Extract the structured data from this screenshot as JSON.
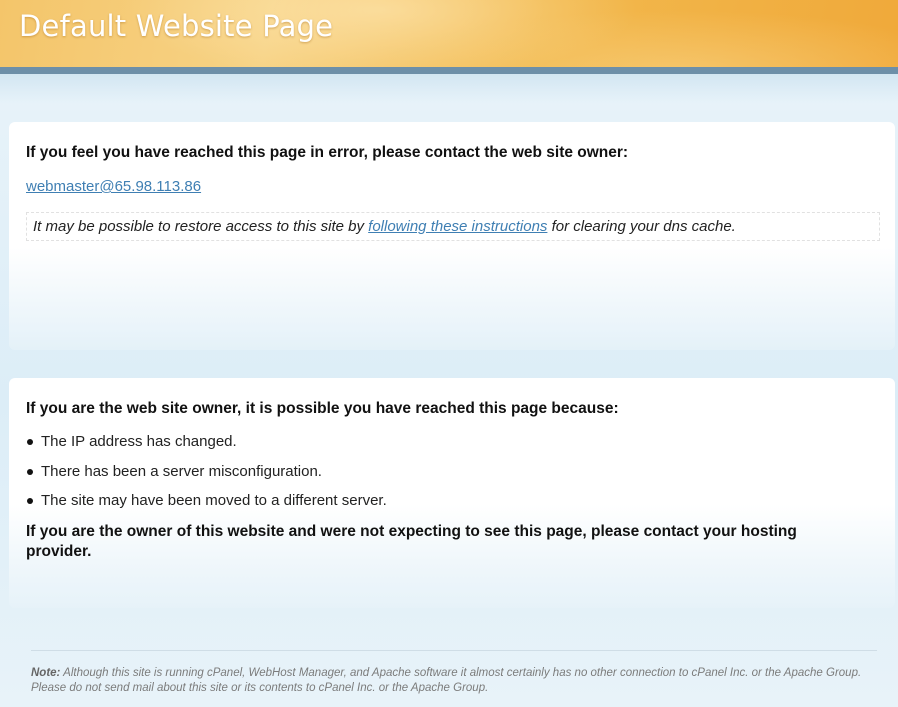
{
  "header": {
    "title": "Default Website Page"
  },
  "error_panel": {
    "heading": "If you feel you have reached this page in error, please contact the web site owner:",
    "email": "webmaster@65.98.113.86",
    "dns_prefix": "It may be possible to restore access to this site by ",
    "dns_link": "following these instructions",
    "dns_suffix": " for clearing your dns cache."
  },
  "owner_panel": {
    "heading": "If you are the web site owner, it is possible you have reached this page because:",
    "reasons": [
      "The IP address has changed.",
      "There has been a server misconfiguration.",
      "The site may have been moved to a different server."
    ],
    "contact": "If you are the owner of this website and were not expecting to see this page, please contact your hosting provider."
  },
  "footer": {
    "note_label": "Note:",
    "note_text": " Although this site is running cPanel, WebHost Manager, and Apache software it almost certainly has no other connection to cPanel Inc. or the Apache Group. Please do not send mail about this site or its contents to cPanel Inc. or the Apache Group."
  },
  "colors": {
    "header_orange": "#f2b94e",
    "header_bar": "#6d8fa8",
    "link_blue": "#3f7fb3",
    "background": "#e6f2f9"
  }
}
